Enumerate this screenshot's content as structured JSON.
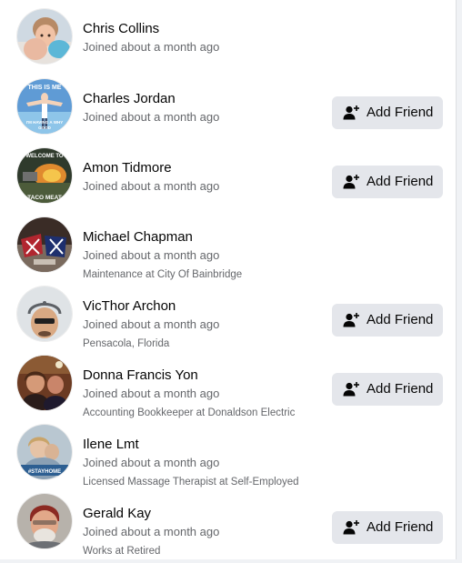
{
  "members": [
    {
      "name": "Chris Collins",
      "joined": "Joined about a month ago",
      "detail": "",
      "button": "",
      "avatar": "avatar-photo"
    },
    {
      "name": "Charles Jordan",
      "joined": "Joined about a month ago",
      "detail": "",
      "button": "Add Friend",
      "avatar": "avatar-photo"
    },
    {
      "name": "Amon Tidmore",
      "joined": "Joined about a month ago",
      "detail": "",
      "button": "Add Friend",
      "avatar": "avatar-photo"
    },
    {
      "name": "Michael Chapman",
      "joined": "Joined about a month ago",
      "detail": "Maintenance at City Of Bainbridge",
      "button": "",
      "avatar": "avatar-photo"
    },
    {
      "name": "VicThor Archon",
      "joined": "Joined about a month ago",
      "detail": "Pensacola, Florida",
      "button": "Add Friend",
      "avatar": "avatar-photo"
    },
    {
      "name": "Donna Francis Yon",
      "joined": "Joined about a month ago",
      "detail": "Accounting Bookkeeper at Donaldson Electric",
      "button": "Add Friend",
      "avatar": "avatar-photo"
    },
    {
      "name": "Ilene Lmt",
      "joined": "Joined about a month ago",
      "detail": "Licensed Massage Therapist at Self-Employed",
      "button": "",
      "avatar": "avatar-photo"
    },
    {
      "name": "Gerald Kay",
      "joined": "Joined about a month ago",
      "detail": "Works at Retired",
      "button": "Add Friend",
      "avatar": "avatar-photo"
    }
  ],
  "avatar_text": {
    "charles_top": "THIS IS ME",
    "charles_bottom": "I'M HAVING A WHY",
    "charles_bottom2": "GOOD",
    "amon_top": "WELCOME TO",
    "amon_bottom": "TACO MEAT",
    "ilene_sign": "#STAYHOME"
  },
  "icons": {
    "add_friend": "add-friend-icon"
  },
  "colors": {
    "button_bg": "#e4e6eb",
    "secondary_text": "#65676b",
    "primary_text": "#050505"
  }
}
